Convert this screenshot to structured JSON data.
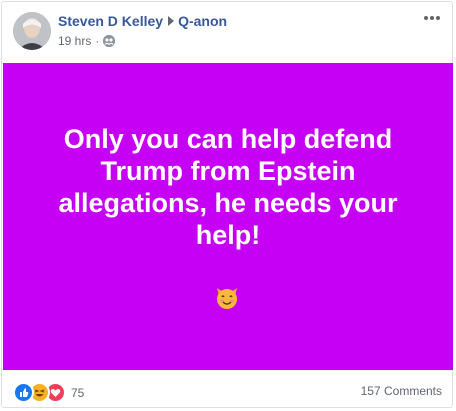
{
  "post": {
    "author": "Steven D Kelley",
    "group": "Q-anon",
    "time": "19 hrs",
    "separator": "·",
    "audience_icon": "group-icon",
    "more_icon": "more-icon",
    "text": "Only you can help defend Trump from Epstein allegations, he needs your help!",
    "emoji": "cat-face-emoji",
    "background_color": "#c600f5"
  },
  "footer": {
    "reaction_icons": [
      "like-icon",
      "haha-icon",
      "love-icon"
    ],
    "reaction_count": "75",
    "comments": "157 Comments"
  }
}
